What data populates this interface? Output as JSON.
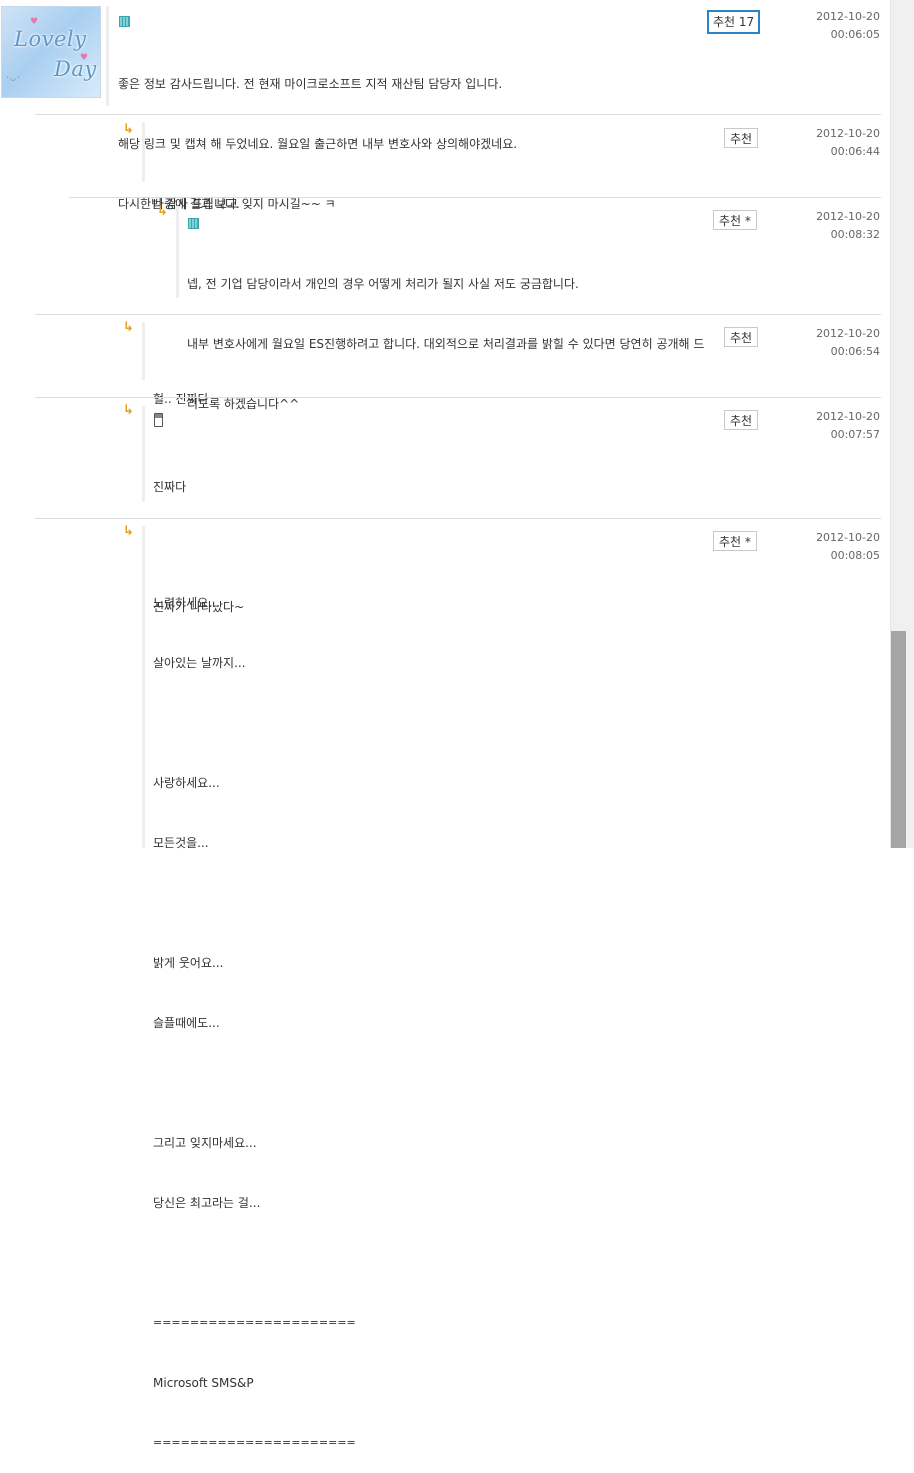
{
  "comments": [
    {
      "badge_icon": "grid-badge-icon",
      "lines": [
        "좋은 정보 감사드립니다. 전 현재 마이크로소프트 지적 재산팀 담당자 입니다.",
        "해당 링크 및 캡쳐 해 두었네요. 월요일 출근하면 내부 변호사와 상의해야겠네요.",
        "다시한번 감사 드립니다."
      ],
      "recommend": "추천 17",
      "date": "2012-10-20",
      "time": "00:06:05"
    },
    {
      "lines": [
        "나중에 결과 보고 잊지 마시길~~ ㅋ"
      ],
      "recommend": "추천",
      "date": "2012-10-20",
      "time": "00:06:44"
    },
    {
      "badge_icon": "grid-badge-icon",
      "lines": [
        "넵, 전 기업 담당이라서 개인의 경우 어떻게 처리가 될지 사실 저도 궁금합니다.",
        "내부 변호사에게 월요일 ES진행하려고 합니다. 대외적으로 처리결과를 밝힐 수 있다면 당연히 공개해 드",
        "리도록 하겠습니다^^"
      ],
      "recommend": "추천 *",
      "date": "2012-10-20",
      "time": "00:08:32"
    },
    {
      "lines": [
        "헐.. 진짜다"
      ],
      "recommend": "추천",
      "date": "2012-10-20",
      "time": "00:06:54"
    },
    {
      "badge_icon": "phone-icon",
      "lines": [
        "진짜다",
        "",
        "진짜가 나타났다~"
      ],
      "recommend": "추천",
      "date": "2012-10-20",
      "time": "00:07:57"
    },
    {
      "lines": [
        "노력하세요...",
        "살아있는 날까지...",
        "",
        "사랑하세요...",
        "모든것을...",
        "",
        "밝게 웃어요...",
        "슬플때에도...",
        "",
        "그리고 잊지마세요...",
        "당신은 최고라는 걸...",
        "",
        "======================",
        "Microsoft SMS&P",
        "======================"
      ],
      "recommend": "추천 *",
      "date": "2012-10-20",
      "time": "00:08:05"
    }
  ],
  "avatar": {
    "word1": "Lovely",
    "word2": "Day"
  },
  "colors": {
    "reply_arrow": "#e2a020",
    "highlight_border": "#2a84c4"
  }
}
